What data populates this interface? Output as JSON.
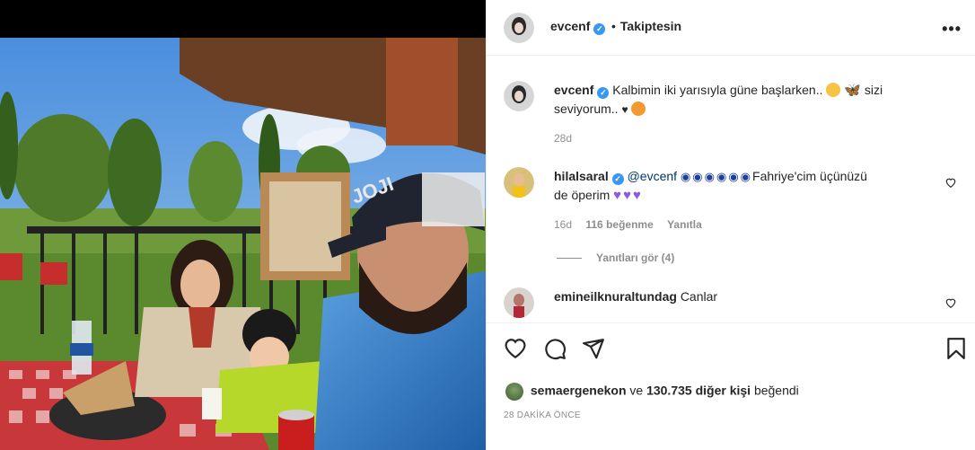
{
  "post": {
    "author": "evcenf",
    "follow_status": "Takiptesin",
    "more_icon": "more-horizontal-icon"
  },
  "caption": {
    "username": "evcenf",
    "text_part1": "Kalbimin iki yarısıyla güne başlarken..",
    "text_part2": "sizi",
    "text_part3": "seviyorum..",
    "time": "28d",
    "emojis": [
      "pensive-face",
      "butterfly",
      "black-heart",
      "smiling-cat-heart-eyes"
    ]
  },
  "comments": [
    {
      "username": "hilalsaral",
      "mention": "@evcenf",
      "text_part1": "Fahriye'cim üçünüzü",
      "text_part2": "de öperim",
      "time": "16d",
      "likes": "116 beğenme",
      "reply": "Yanıtla",
      "view_replies": "Yanıtları gör (4)"
    },
    {
      "username": "emineilknuraltundag",
      "text": "Canlar"
    }
  ],
  "actions": {
    "like_icon": "heart-icon",
    "comment_icon": "comment-icon",
    "share_icon": "paper-plane-icon",
    "save_icon": "bookmark-icon"
  },
  "likes": {
    "user": "semaergenekon",
    "connector": "ve",
    "count": "130.735 diğer kişi",
    "suffix": "beğendi"
  },
  "timestamp": "28 DAKİKA ÖNCE",
  "colors": {
    "verified": "#3897f0",
    "mention": "#00376b",
    "muted": "#8e8e8e",
    "text": "#262626",
    "border": "#efefef"
  }
}
